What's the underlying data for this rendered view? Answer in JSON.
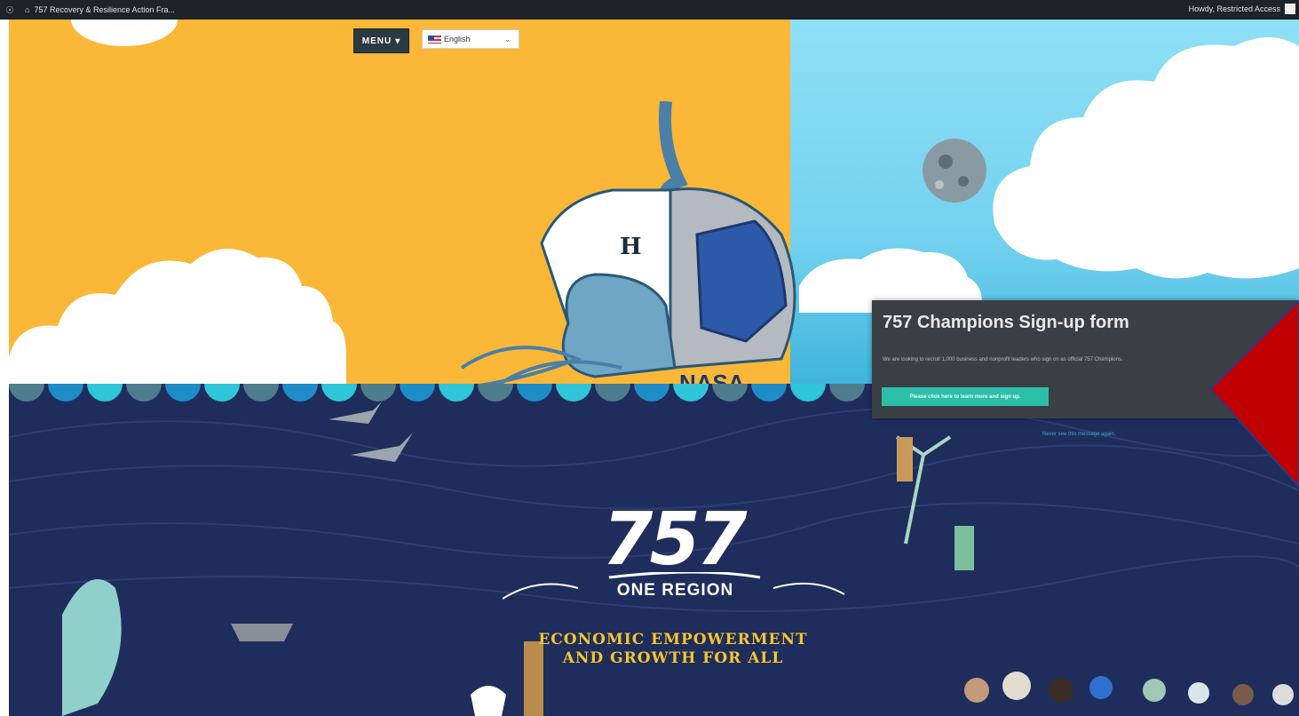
{
  "admin_bar": {
    "site_title": "757 Recovery & Resilience Action Fra...",
    "howdy": "Howdy, Restricted Access"
  },
  "nav": {
    "menu_label": "MENU",
    "language_selected": "English"
  },
  "popup": {
    "title": "757 Champions Sign-up form",
    "body": "We are looking to recruit 1,000 business and nonprofit leaders who sign on as official 757 Champions.",
    "cta_label": "Please click here to learn more and sign up.",
    "dismiss_label": "Never see this message again."
  },
  "hero": {
    "logo_number": "757",
    "region_label": "ONE REGION",
    "tagline_line1": "ECONOMIC EMPOWERMENT",
    "tagline_line2": "AND GROWTH FOR ALL",
    "helmet_badge": "NASA",
    "cap_emblem": "H"
  },
  "colors": {
    "sky_yellow": "#fbb737",
    "sky_blue": "#8ee0f5",
    "sea_navy": "#1f2d5c",
    "popup_bg": "#3a3f44",
    "cta_teal": "#2bbfa8",
    "overlay_red": "#c00000"
  }
}
